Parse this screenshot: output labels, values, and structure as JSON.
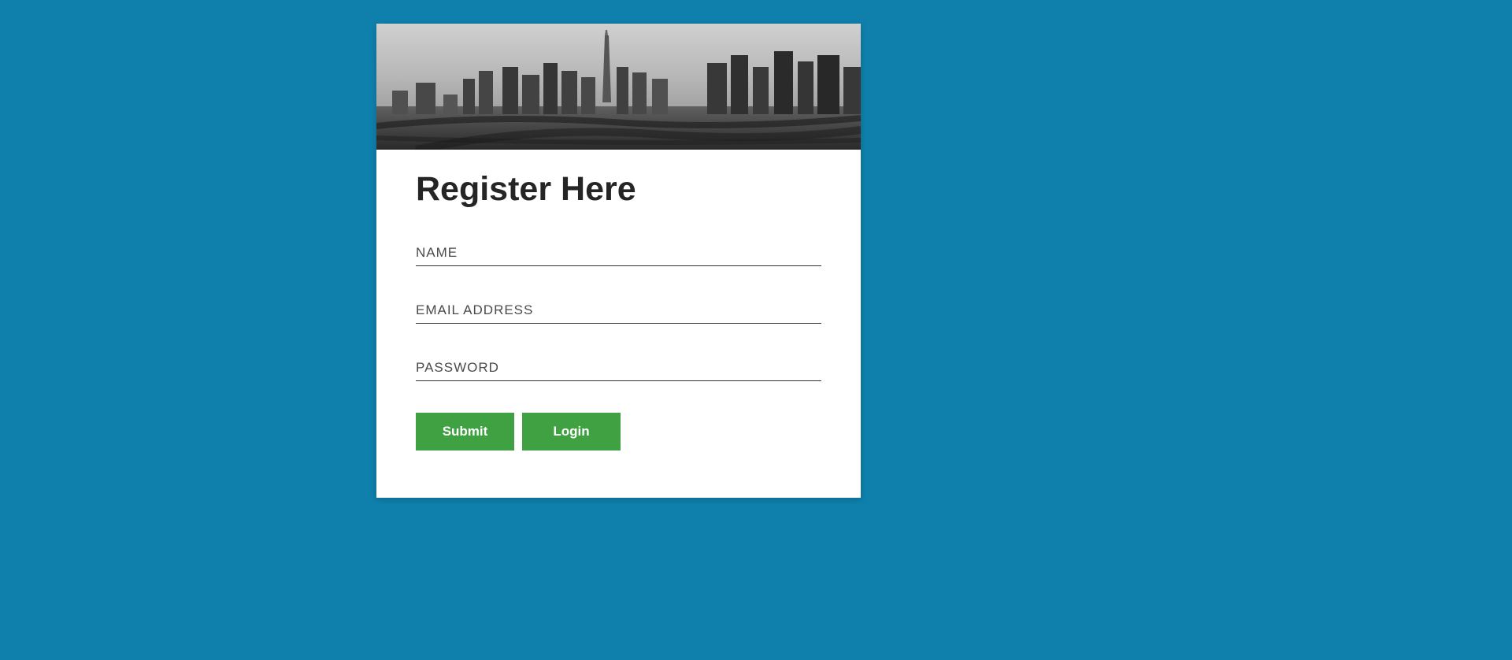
{
  "page_title": "Register Here",
  "fields": {
    "name": {
      "placeholder": "NAME",
      "value": ""
    },
    "email": {
      "placeholder": "EMAIL ADDRESS",
      "value": ""
    },
    "password": {
      "placeholder": "PASSWORD",
      "value": ""
    }
  },
  "buttons": {
    "submit": "Submit",
    "login": "Login"
  },
  "colors": {
    "background": "#0f80ac",
    "button": "#3fa142",
    "text": "#252525"
  }
}
